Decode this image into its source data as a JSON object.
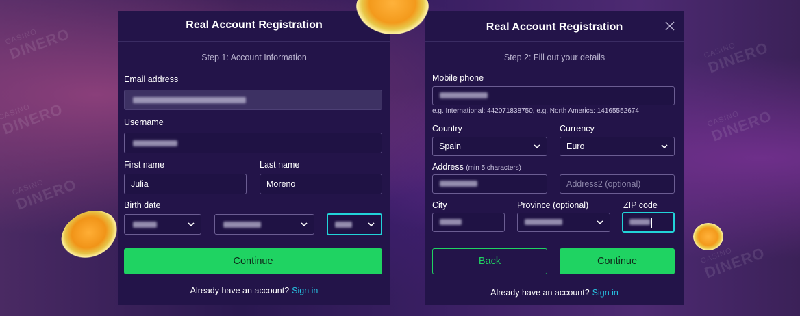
{
  "watermark": {
    "line1": "CASINO",
    "line2": "DINERO"
  },
  "step1": {
    "title": "Real Account Registration",
    "step": "Step 1: Account Information",
    "email_label": "Email address",
    "username_label": "Username",
    "first_name_label": "First name",
    "first_name_value": "Julia",
    "last_name_label": "Last name",
    "last_name_value": "Moreno",
    "birth_date_label": "Birth date",
    "continue_label": "Continue",
    "footer_text": "Already have an account?",
    "signin_label": "Sign in"
  },
  "step2": {
    "title": "Real Account Registration",
    "step": "Step 2: Fill out your details",
    "mobile_label": "Mobile phone",
    "mobile_hint": "e.g. International: 442071838750, e.g. North America: 14165552674",
    "country_label": "Country",
    "country_value": "Spain",
    "currency_label": "Currency",
    "currency_value": "Euro",
    "address_label": "Address",
    "address_note": "(min 5 characters)",
    "address2_placeholder": "Address2 (optional)",
    "city_label": "City",
    "province_label": "Province (optional)",
    "zip_label": "ZIP code",
    "back_label": "Back",
    "continue_label": "Continue",
    "footer_text": "Already have an account?",
    "signin_label": "Sign in"
  },
  "icons": {
    "close": "close-icon",
    "chevron": "chevron-down-icon"
  },
  "colors": {
    "accent": "#1fd362",
    "link": "#27c1e0",
    "focus": "#22d3d8",
    "panel": "#231449"
  }
}
